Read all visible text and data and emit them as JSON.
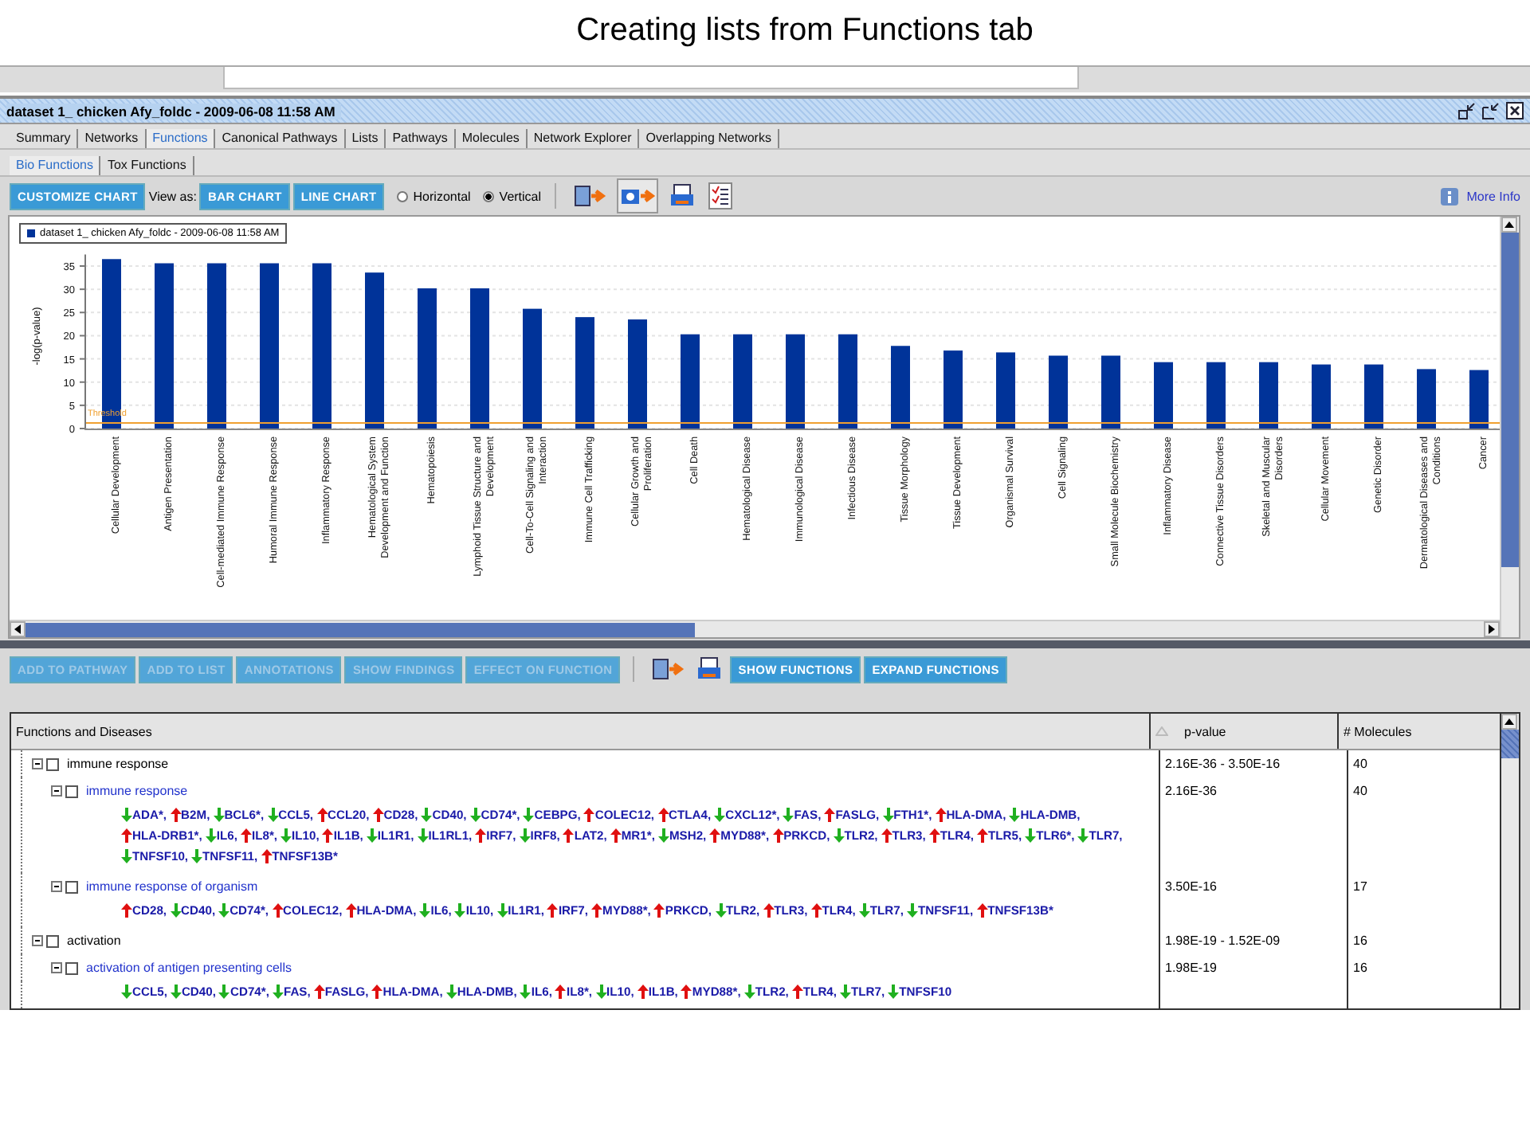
{
  "slide_title": "Creating lists from Functions tab",
  "window": {
    "title": "dataset 1_ chicken Afy_foldc - 2009-06-08 11:58 AM"
  },
  "tabs": [
    {
      "label": "Summary",
      "selected": false
    },
    {
      "label": "Networks",
      "selected": false
    },
    {
      "label": "Functions",
      "selected": true
    },
    {
      "label": "Canonical Pathways",
      "selected": false
    },
    {
      "label": "Lists",
      "selected": false
    },
    {
      "label": "Pathways",
      "selected": false
    },
    {
      "label": "Molecules",
      "selected": false
    },
    {
      "label": "Network Explorer",
      "selected": false
    },
    {
      "label": "Overlapping Networks",
      "selected": false
    }
  ],
  "subtabs": [
    {
      "label": "Bio Functions",
      "selected": true
    },
    {
      "label": "Tox Functions",
      "selected": false
    }
  ],
  "chart_toolbar": {
    "customize": "CUSTOMIZE CHART",
    "view_as": "View as:",
    "chart_types": [
      "BAR CHART",
      "LINE CHART"
    ],
    "orientations": [
      {
        "label": "Horizontal",
        "selected": false
      },
      {
        "label": "Vertical",
        "selected": true
      }
    ],
    "more_info": "More Info"
  },
  "chart": {
    "chart_data": {
      "type": "bar",
      "ylabel": "-log(p-value)",
      "categories": [
        "Cellular Development",
        "Antigen Presentation",
        "Cell-mediated Immune Response",
        "Humoral Immune Response",
        "Inflammatory Response",
        "Hematological System Development and Function",
        "Hematopoiesis",
        "Lymphoid Tissue Structure and Development",
        "Cell-To-Cell Signaling and Interaction",
        "Immune Cell Trafficking",
        "Cellular Growth and Proliferation",
        "Cell Death",
        "Hematological Disease",
        "Immunological Disease",
        "Infectious Disease",
        "Tissue Morphology",
        "Tissue Development",
        "Organismal Survival",
        "Cell Signaling",
        "Small Molecule Biochemistry",
        "Inflammatory Disease",
        "Connective Tissue Disorders",
        "Skeletal and Muscular Disorders",
        "Cellular Movement",
        "Genetic Disorder",
        "Dermatological Diseases and Conditions",
        "Cancer"
      ],
      "series": [
        {
          "name": "dataset 1_ chicken Afy_foldc - 2009-06-08 11:58 AM",
          "color": "#003399",
          "values": [
            36.5,
            35.6,
            35.6,
            35.6,
            35.6,
            33.6,
            30.2,
            30.2,
            25.8,
            24.0,
            23.5,
            20.3,
            20.3,
            20.3,
            20.3,
            17.8,
            16.8,
            16.4,
            15.7,
            15.7,
            14.3,
            14.3,
            14.3,
            13.8,
            13.8,
            12.8,
            12.6
          ]
        }
      ],
      "ylim": [
        0,
        37.5
      ],
      "yticks": [
        0,
        5,
        10,
        15,
        20,
        25,
        30,
        35
      ],
      "grid": true
    },
    "threshold": {
      "label": "Threshold",
      "color": "#f0a030"
    }
  },
  "table_toolbar": {
    "action_buttons": [
      {
        "label": "ADD TO PATHWAY",
        "disabled": true
      },
      {
        "label": "ADD TO LIST",
        "disabled": true
      },
      {
        "label": "ANNOTATIONS",
        "disabled": true
      },
      {
        "label": "SHOW FINDINGS",
        "disabled": true
      },
      {
        "label": "EFFECT ON FUNCTION",
        "disabled": true
      }
    ],
    "view_buttons": [
      {
        "label": "SHOW FUNCTIONS",
        "disabled": false
      },
      {
        "label": "EXPAND FUNCTIONS",
        "disabled": false
      }
    ]
  },
  "table": {
    "columns": [
      "Functions and Diseases",
      "p-value",
      "# Molecules"
    ],
    "separator": ", ",
    "rows": [
      {
        "name": "immune response",
        "p_value": "2.16E-36 - 3.50E-16",
        "count": "40",
        "expanded": true,
        "checked": false,
        "children": [
          {
            "name": "immune response",
            "p_value": "2.16E-36",
            "count": "40",
            "expanded": true,
            "checked": false,
            "molecules": [
              {
                "symbol": "ADA*",
                "up": false
              },
              {
                "symbol": "B2M",
                "up": true
              },
              {
                "symbol": "BCL6*",
                "up": false
              },
              {
                "symbol": "CCL5",
                "up": false
              },
              {
                "symbol": "CCL20",
                "up": true
              },
              {
                "symbol": "CD28",
                "up": true
              },
              {
                "symbol": "CD40",
                "up": false
              },
              {
                "symbol": "CD74*",
                "up": false
              },
              {
                "symbol": "CEBPG",
                "up": false
              },
              {
                "symbol": "COLEC12",
                "up": true
              },
              {
                "symbol": "CTLA4",
                "up": true
              },
              {
                "symbol": "CXCL12*",
                "up": false
              },
              {
                "symbol": "FAS",
                "up": false
              },
              {
                "symbol": "FASLG",
                "up": true
              },
              {
                "symbol": "FTH1*",
                "up": false
              },
              {
                "symbol": "HLA-DMA",
                "up": true
              },
              {
                "symbol": "HLA-DMB",
                "up": false
              },
              {
                "symbol": "HLA-DRB1*",
                "up": true
              },
              {
                "symbol": "IL6",
                "up": false
              },
              {
                "symbol": "IL8*",
                "up": true
              },
              {
                "symbol": "IL10",
                "up": false
              },
              {
                "symbol": "IL1B",
                "up": true
              },
              {
                "symbol": "IL1R1",
                "up": false
              },
              {
                "symbol": "IL1RL1",
                "up": false
              },
              {
                "symbol": "IRF7",
                "up": true
              },
              {
                "symbol": "IRF8",
                "up": false
              },
              {
                "symbol": "LAT2",
                "up": true
              },
              {
                "symbol": "MR1*",
                "up": true
              },
              {
                "symbol": "MSH2",
                "up": false
              },
              {
                "symbol": "MYD88*",
                "up": true
              },
              {
                "symbol": "PRKCD",
                "up": true
              },
              {
                "symbol": "TLR2",
                "up": false
              },
              {
                "symbol": "TLR3",
                "up": true
              },
              {
                "symbol": "TLR4",
                "up": true
              },
              {
                "symbol": "TLR5",
                "up": true
              },
              {
                "symbol": "TLR6*",
                "up": false
              },
              {
                "symbol": "TLR7",
                "up": false
              },
              {
                "symbol": "TNFSF10",
                "up": false
              },
              {
                "symbol": "TNFSF11",
                "up": false
              },
              {
                "symbol": "TNFSF13B*",
                "up": true
              }
            ]
          },
          {
            "name": "immune response of organism",
            "p_value": "3.50E-16",
            "count": "17",
            "expanded": true,
            "checked": false,
            "molecules": [
              {
                "symbol": "CD28",
                "up": true
              },
              {
                "symbol": "CD40",
                "up": false
              },
              {
                "symbol": "CD74*",
                "up": false
              },
              {
                "symbol": "COLEC12",
                "up": true
              },
              {
                "symbol": "HLA-DMA",
                "up": true
              },
              {
                "symbol": "IL6",
                "up": false
              },
              {
                "symbol": "IL10",
                "up": false
              },
              {
                "symbol": "IL1R1",
                "up": false
              },
              {
                "symbol": "IRF7",
                "up": true
              },
              {
                "symbol": "MYD88*",
                "up": true
              },
              {
                "symbol": "PRKCD",
                "up": true
              },
              {
                "symbol": "TLR2",
                "up": false
              },
              {
                "symbol": "TLR3",
                "up": true
              },
              {
                "symbol": "TLR4",
                "up": true
              },
              {
                "symbol": "TLR7",
                "up": false
              },
              {
                "symbol": "TNFSF11",
                "up": false
              },
              {
                "symbol": "TNFSF13B*",
                "up": true
              }
            ]
          }
        ]
      },
      {
        "name": "activation",
        "p_value": "1.98E-19 - 1.52E-09",
        "count": "16",
        "expanded": true,
        "checked": false,
        "children": [
          {
            "name": "activation of antigen presenting cells",
            "p_value": "1.98E-19",
            "count": "16",
            "expanded": true,
            "checked": false,
            "molecules": [
              {
                "symbol": "CCL5",
                "up": false
              },
              {
                "symbol": "CD40",
                "up": false
              },
              {
                "symbol": "CD74*",
                "up": false
              },
              {
                "symbol": "FAS",
                "up": false
              },
              {
                "symbol": "FASLG",
                "up": true
              },
              {
                "symbol": "HLA-DMA",
                "up": true
              },
              {
                "symbol": "HLA-DMB",
                "up": false
              },
              {
                "symbol": "IL6",
                "up": false
              },
              {
                "symbol": "IL8*",
                "up": true
              },
              {
                "symbol": "IL10",
                "up": false
              },
              {
                "symbol": "IL1B",
                "up": true
              },
              {
                "symbol": "MYD88*",
                "up": true
              },
              {
                "symbol": "TLR2",
                "up": false
              },
              {
                "symbol": "TLR4",
                "up": true
              },
              {
                "symbol": "TLR7",
                "up": false
              },
              {
                "symbol": "TNFSF10",
                "up": false
              }
            ]
          }
        ]
      }
    ]
  }
}
